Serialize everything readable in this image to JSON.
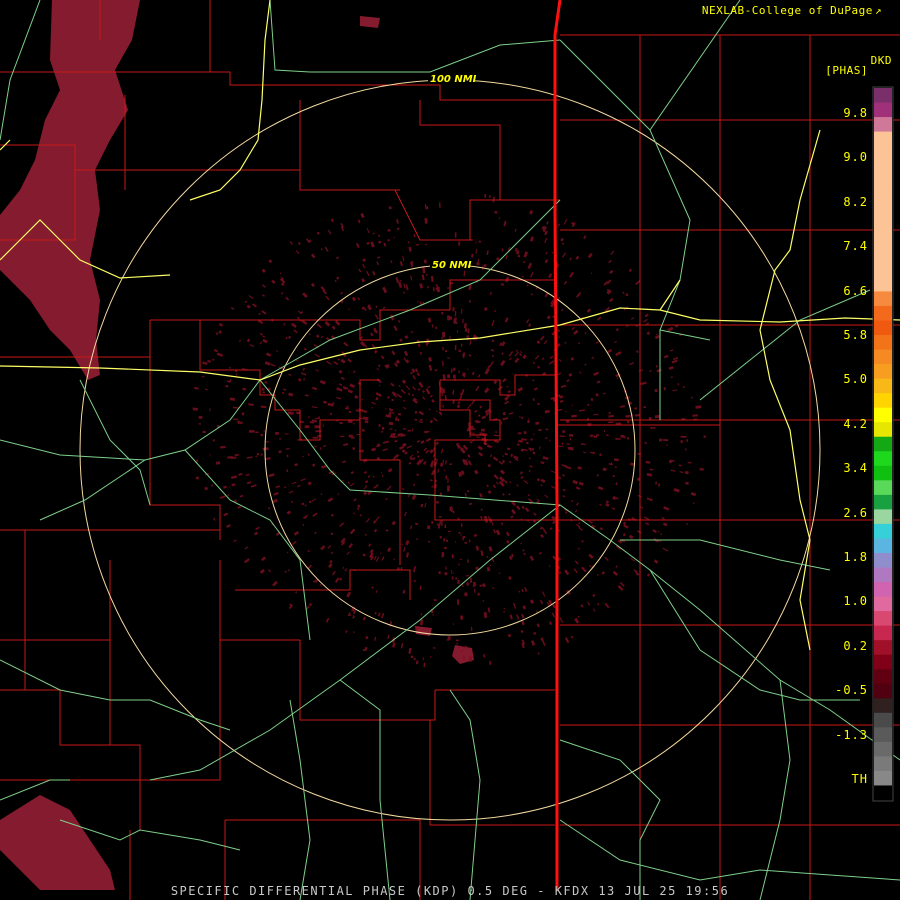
{
  "header": {
    "credit": "NEXLAB-College of DuPage",
    "credit_mark": "↗"
  },
  "footer": {
    "product_line": "SPECIFIC DIFFERENTIAL PHASE (KDP) 0.5 DEG - KFDX 13 JUL 25 19:56"
  },
  "legend": {
    "unit_top": "DKD",
    "unit_sub": "[PHAS]",
    "ticks": [
      "9.8",
      "9.0",
      "8.2",
      "7.4",
      "6.6",
      "5.8",
      "5.0",
      "4.2",
      "3.4",
      "2.6",
      "1.8",
      "1.0",
      "0.2",
      "-0.5",
      "-1.3",
      "TH"
    ],
    "colors": [
      "#7a2f6b",
      "#a0307a",
      "#d07898",
      "#fbc396",
      "#fbc396",
      "#fbc396",
      "#fbc396",
      "#fbc396",
      "#fbc396",
      "#fbc396",
      "#fbc396",
      "#fbc396",
      "#fbc396",
      "#fbc396",
      "#f68a3e",
      "#f46a1c",
      "#f05a10",
      "#f27318",
      "#f58a22",
      "#f79e20",
      "#f8b818",
      "#ffd400",
      "#ffff00",
      "#e6e600",
      "#15a815",
      "#1ed81e",
      "#10c010",
      "#5ad85a",
      "#19a040",
      "#9ad6a0",
      "#36d0d8",
      "#5ab6e0",
      "#8e8ecc",
      "#b078c0",
      "#d064b0",
      "#e06aa0",
      "#d84870",
      "#c82850",
      "#a01028",
      "#800018",
      "#600010",
      "#500010",
      "#302020",
      "#4a4a4a",
      "#5a5a5a",
      "#6a6a6a",
      "#7a7a7a",
      "#888888",
      "#000000"
    ]
  },
  "rings": {
    "outer_label": "100 NMI",
    "inner_label": "50 NMI"
  },
  "colors": {
    "county_lines": "#c81818",
    "highways": "#7ed08a",
    "rings": "#f4d9a0",
    "state_line": "#ff1010",
    "interstate": "#ffff66",
    "echo": "#8c1020"
  }
}
